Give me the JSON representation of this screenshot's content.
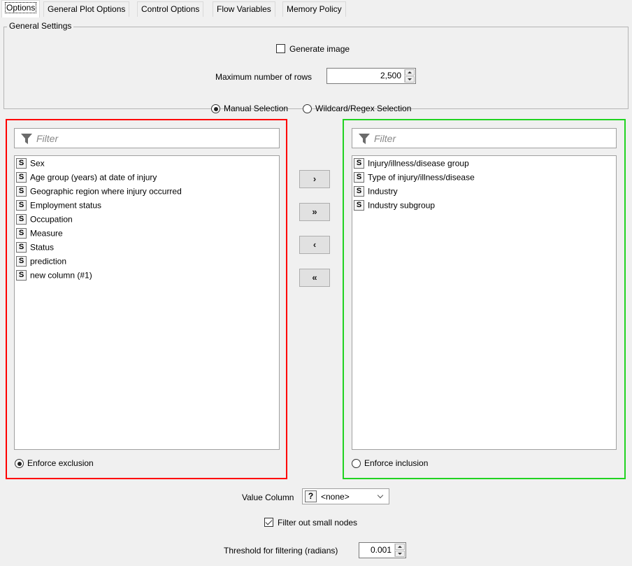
{
  "tabs": [
    "Options",
    "General Plot Options",
    "Control Options",
    "Flow Variables",
    "Memory Policy"
  ],
  "general_settings": {
    "title": "General Settings",
    "generate_image_label": "Generate image",
    "generate_image_checked": false,
    "max_rows_label": "Maximum number of rows",
    "max_rows_value": "2,500"
  },
  "selection_mode": {
    "manual_label": "Manual Selection",
    "wildcard_label": "Wildcard/Regex Selection",
    "selected": "manual"
  },
  "exclude_panel": {
    "filter_placeholder": "Filter",
    "items": [
      {
        "type": "S",
        "label": "Sex"
      },
      {
        "type": "S",
        "label": "Age group (years) at date of injury"
      },
      {
        "type": "S",
        "label": "Geographic region where injury occurred"
      },
      {
        "type": "S",
        "label": "Employment status"
      },
      {
        "type": "S",
        "label": "Occupation"
      },
      {
        "type": "S",
        "label": "Measure"
      },
      {
        "type": "S",
        "label": "Status"
      },
      {
        "type": "S",
        "label": "prediction"
      },
      {
        "type": "S",
        "label": "new column (#1)"
      }
    ],
    "enforce_label": "Enforce exclusion",
    "enforce_selected": true,
    "border_color": "#ff0000"
  },
  "include_panel": {
    "filter_placeholder": "Filter",
    "items": [
      {
        "type": "S",
        "label": "Injury/illness/disease group"
      },
      {
        "type": "S",
        "label": "Type of injury/illness/disease"
      },
      {
        "type": "S",
        "label": "Industry"
      },
      {
        "type": "S",
        "label": "Industry subgroup"
      }
    ],
    "enforce_label": "Enforce inclusion",
    "enforce_selected": false,
    "border_color": "#21d321"
  },
  "move_buttons": {
    "add": "›",
    "add_all": "»",
    "remove": "‹",
    "remove_all": "«"
  },
  "value_column": {
    "label": "Value Column",
    "type_badge": "?",
    "selected": "<none>"
  },
  "filter_small_nodes": {
    "label": "Filter out small nodes",
    "checked": true
  },
  "threshold": {
    "label": "Threshold for filtering (radians)",
    "value": "0.001"
  },
  "icons": {
    "filter": "filter-funnel-icon",
    "spinner_up": "caret-up-icon",
    "spinner_down": "caret-down-icon",
    "dropdown": "chevron-down-icon"
  }
}
